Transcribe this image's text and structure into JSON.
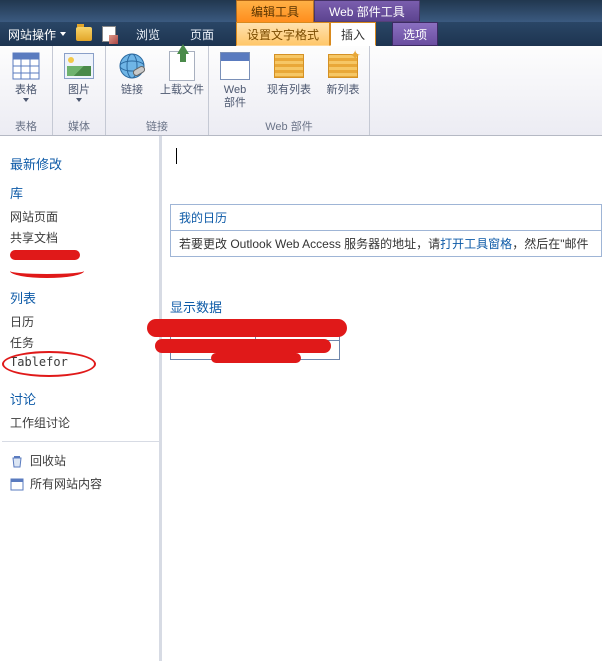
{
  "contextual_tabs": {
    "edit_tools": "编辑工具",
    "webpart_tools": "Web 部件工具"
  },
  "menu": {
    "site_actions": "网站操作",
    "browse": "浏览",
    "page": "页面",
    "format_text": "设置文字格式",
    "insert": "插入",
    "options": "选项"
  },
  "ribbon": {
    "groups": {
      "tables": "表格",
      "media": "媒体",
      "links": "链接",
      "webparts": "Web 部件"
    },
    "buttons": {
      "table": "表格",
      "image": "图片",
      "link": "链接",
      "upload": "上载文件",
      "webpart_top": "Web",
      "webpart_bottom": "部件",
      "existing_list": "现有列表",
      "new_list": "新列表"
    }
  },
  "sidebar": {
    "recent": "最新修改",
    "libraries": "库",
    "site_pages": "网站页面",
    "shared_docs": "共享文档",
    "lists": "列表",
    "calendar": "日历",
    "tasks": "任务",
    "tablefor": "Tablefor",
    "discussions": "讨论",
    "team_discussion": "工作组讨论",
    "recycle_bin": "回收站",
    "all_content": "所有网站内容"
  },
  "main": {
    "my_calendar_title": "我的日历",
    "calendar_hint_prefix": "若要更改 Outlook Web Access 服务器的地址，请",
    "calendar_hint_link": "打开工具窗格",
    "calendar_hint_suffix": "，然后在\"邮件",
    "display_data": "显示数据"
  }
}
